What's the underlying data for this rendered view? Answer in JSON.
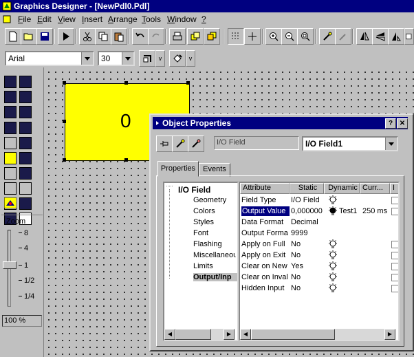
{
  "window": {
    "title": "Graphics Designer - [NewPdl0.Pdl]"
  },
  "menu": [
    {
      "label": "File",
      "u": "F",
      "rest": "ile"
    },
    {
      "label": "Edit",
      "u": "E",
      "rest": "dit"
    },
    {
      "label": "View",
      "u": "V",
      "rest": "iew"
    },
    {
      "label": "Insert",
      "u": "I",
      "rest": "nsert"
    },
    {
      "label": "Arrange",
      "u": "A",
      "rest": "rrange"
    },
    {
      "label": "Tools",
      "u": "T",
      "rest": "ools"
    },
    {
      "label": "Window",
      "u": "W",
      "rest": "indow"
    },
    {
      "label": "?",
      "u": "?",
      "rest": ""
    }
  ],
  "format": {
    "font": "Arial",
    "size": "30"
  },
  "canvas_object": {
    "value": "0",
    "color": "#ffff00"
  },
  "zoom": {
    "title": "Zoom",
    "levels": [
      "8",
      "4",
      "1",
      "1/2",
      "1/4"
    ],
    "value": "100 %"
  },
  "dialog": {
    "title": "Object Properties",
    "object_type": "I/O Field",
    "object_name": "I/O Field1",
    "tabs": [
      "Properties",
      "Events"
    ],
    "tree_root": "I/O Field",
    "tree_items": [
      "Geometry",
      "Colors",
      "Styles",
      "Font",
      "Flashing",
      "Miscellaneou",
      "Limits",
      "Output/Inp"
    ],
    "headers": [
      "Attribute",
      "Static",
      "Dynamic",
      "Curr...",
      "I"
    ],
    "rows": [
      {
        "attr": "Field Type",
        "static": "I/O Field",
        "dyn": "bulb",
        "dyntext": "",
        "curr": ""
      },
      {
        "attr": "Output Value",
        "static": "0,000000",
        "dyn": "bulb-active",
        "dyntext": "Test1",
        "curr": "250 ms"
      },
      {
        "attr": "Data Format",
        "static": "Decimal",
        "dyn": "",
        "dyntext": "",
        "curr": ""
      },
      {
        "attr": "Output Format",
        "static": "9999",
        "dyn": "",
        "dyntext": "",
        "curr": ""
      },
      {
        "attr": "Apply on Full",
        "static": "No",
        "dyn": "bulb",
        "dyntext": "",
        "curr": ""
      },
      {
        "attr": "Apply on Exit",
        "static": "No",
        "dyn": "bulb",
        "dyntext": "",
        "curr": ""
      },
      {
        "attr": "Clear on New",
        "static": "Yes",
        "dyn": "bulb",
        "dyntext": "",
        "curr": ""
      },
      {
        "attr": "Clear on Invali",
        "static": "No",
        "dyn": "bulb",
        "dyntext": "",
        "curr": ""
      },
      {
        "attr": "Hidden Input",
        "static": "No",
        "dyn": "bulb",
        "dyntext": "",
        "curr": ""
      }
    ]
  },
  "colors": {
    "titlebar": "#000080",
    "swatch_dark": "#1a1a4a",
    "swatch_yellow": "#ffff00"
  }
}
